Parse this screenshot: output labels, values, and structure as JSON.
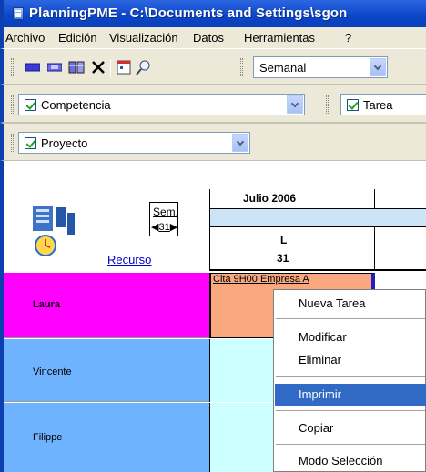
{
  "window": {
    "title": "PlanningPME - C:\\Documents and Settings\\sgon"
  },
  "menubar": {
    "items": [
      "Archivo",
      "Edición",
      "Visualización",
      "Datos",
      "Herramientas",
      "?"
    ]
  },
  "toolbar1": {
    "buttons": [
      "color-bar-icon",
      "color-bar-alt-icon",
      "filter-icon",
      "delete-x-icon",
      "calendar-icon",
      "zoom-icon"
    ],
    "view_select": "Semanal"
  },
  "toolbar2": {
    "filter1": "Competencia",
    "filter2": "Tarea"
  },
  "toolbar3": {
    "filter3": "Proyecto"
  },
  "planning": {
    "week_label": "Sem.",
    "week_number": "31",
    "resource_link": "Recurso",
    "month": "Julio 2006",
    "day_letter": "L",
    "day_number": "31",
    "rows": [
      {
        "name": "Laura",
        "bg": "#ff00ff"
      },
      {
        "name": "Vincente",
        "bg": "#6fb3ff"
      },
      {
        "name": "Filippe",
        "bg": "#6fb3ff"
      }
    ],
    "appointment": "Cita 9H00 Empresa A"
  },
  "context_menu": {
    "items": [
      "Nueva Tarea",
      "Modificar",
      "Eliminar",
      "Imprimir",
      "Copiar",
      "Modo Selección"
    ],
    "highlighted": "Imprimir"
  },
  "colors": {
    "titlebar": "#0b46c9",
    "chrome": "#ece9d8",
    "highlight": "#316ac5",
    "appointment": "#f9a87f",
    "empty_cell": "#ccffff"
  }
}
